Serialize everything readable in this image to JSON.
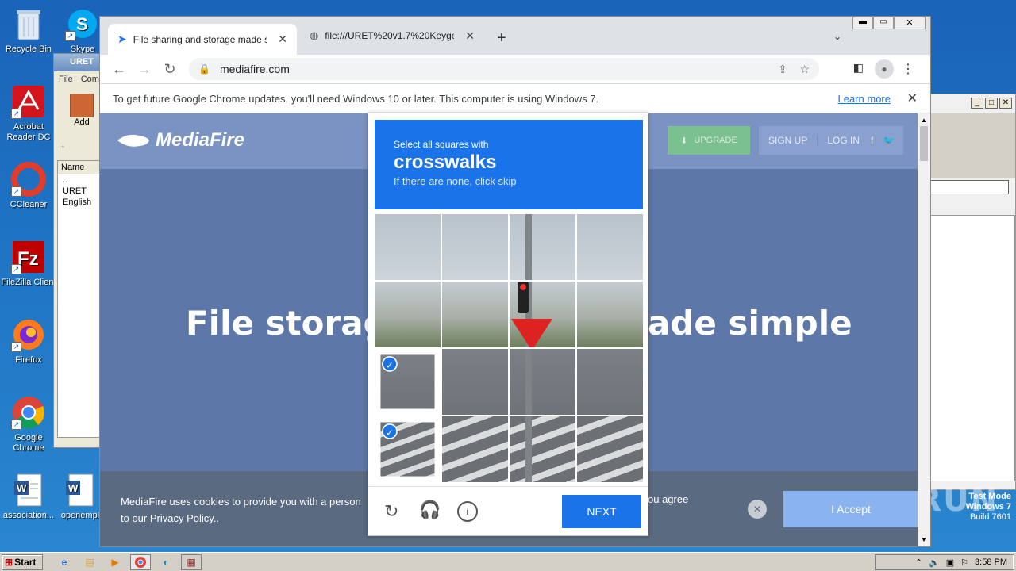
{
  "desktop": {
    "icons": [
      {
        "label": "Recycle Bin"
      },
      {
        "label": "Skype"
      },
      {
        "label": "Acrobat Reader DC"
      },
      {
        "label": "CCleaner"
      },
      {
        "label": "FileZilla Client"
      },
      {
        "label": "Firefox"
      },
      {
        "label": "Google Chrome"
      },
      {
        "label": "association..."
      },
      {
        "label": "openempl"
      }
    ],
    "testmode": {
      "line1": "Test Mode",
      "line2": "Windows 7",
      "line3": "Build 7601"
    },
    "watermark": "ANY RUN"
  },
  "winrar": {
    "title": "URET",
    "menu": [
      "File",
      "Com"
    ],
    "add_label": "Add",
    "name_header": "Name",
    "files": [
      "..",
      "URET",
      "English"
    ]
  },
  "chrome": {
    "tabs": [
      {
        "title": "File sharing and storage made simple"
      },
      {
        "title": "file:///URET%20v1.7%20Keygen%"
      }
    ],
    "url": "mediafire.com",
    "infobar": {
      "text": "To get future Google Chrome updates, you'll need Windows 10 or later. This computer is using Windows 7.",
      "link": "Learn more"
    }
  },
  "mediafire": {
    "logo": "MediaFire",
    "upgrade": "UPGRADE",
    "signup": "SIGN UP",
    "login": "LOG IN",
    "hero_left": "File storag",
    "hero_right": "ade simple",
    "cookie_text_left": "MediaFire uses cookies to provide you with a person",
    "cookie_text_left2": "to our Privacy Policy..",
    "cookie_text_right": "ou agree",
    "accept": "I Accept"
  },
  "captcha": {
    "instruction": "Select all squares with",
    "target": "crosswalks",
    "hint": "If there are none, click skip",
    "next": "NEXT",
    "selected_tiles": [
      8,
      12
    ]
  },
  "taskbar": {
    "start": "Start",
    "time": "3:58 PM"
  }
}
